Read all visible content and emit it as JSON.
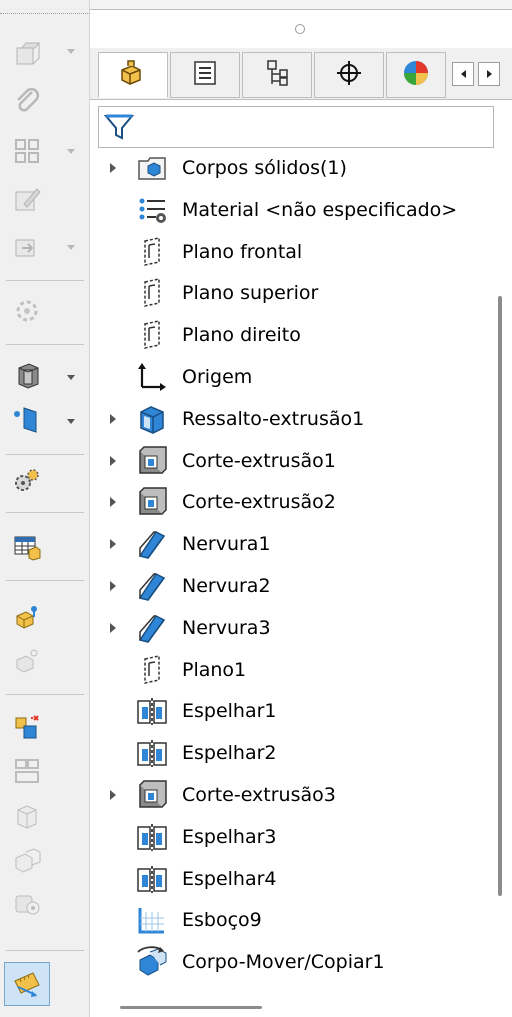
{
  "left_toolbar": {
    "buttons": [
      {
        "icon": "new-part-icon",
        "enabled": false,
        "has_menu": true
      },
      {
        "icon": "paperclip-icon",
        "enabled": false,
        "has_menu": false
      },
      {
        "icon": "pattern-icon",
        "enabled": false,
        "has_menu": true
      },
      {
        "icon": "edit-sketch-icon",
        "enabled": false,
        "has_menu": false
      },
      {
        "icon": "insert-part-icon",
        "enabled": false,
        "has_menu": true
      },
      {
        "icon": "rebuild-icon",
        "enabled": false,
        "has_menu": false
      },
      {
        "icon": "extrude-icon",
        "enabled": true,
        "has_menu": true
      },
      {
        "icon": "reference-plane-icon",
        "enabled": true,
        "has_menu": true
      },
      {
        "icon": "gears-icon",
        "enabled": true,
        "has_menu": false
      },
      {
        "icon": "table-icon",
        "enabled": true,
        "has_menu": false
      },
      {
        "icon": "configuration-icon",
        "enabled": true,
        "has_menu": false
      },
      {
        "icon": "configuration-disabled-icon",
        "enabled": false,
        "has_menu": false
      },
      {
        "icon": "split-part-icon",
        "enabled": true,
        "has_menu": false
      },
      {
        "icon": "weldment-icon",
        "enabled": false,
        "has_menu": false
      },
      {
        "icon": "cube-icon",
        "enabled": false,
        "has_menu": false
      },
      {
        "icon": "assembly-icon",
        "enabled": false,
        "has_menu": false
      },
      {
        "icon": "camera-icon",
        "enabled": false,
        "has_menu": false
      },
      {
        "icon": "measure-icon",
        "enabled": true,
        "has_menu": false
      }
    ]
  },
  "tabs": [
    {
      "icon": "feature-manager-icon",
      "active": true
    },
    {
      "icon": "property-manager-icon",
      "active": false
    },
    {
      "icon": "configuration-manager-icon",
      "active": false
    },
    {
      "icon": "dimxpert-icon",
      "active": false
    },
    {
      "icon": "display-manager-icon",
      "active": false
    }
  ],
  "filter": {
    "icon": "filter-icon"
  },
  "tree": [
    {
      "label": "Corpos sólidos(1)",
      "icon": "solid-bodies-folder-icon",
      "expandable": true
    },
    {
      "label": "Material <não especificado>",
      "icon": "material-icon",
      "expandable": false
    },
    {
      "label": "Plano frontal",
      "icon": "plane-icon",
      "expandable": false
    },
    {
      "label": "Plano superior",
      "icon": "plane-icon",
      "expandable": false
    },
    {
      "label": "Plano direito",
      "icon": "plane-icon",
      "expandable": false
    },
    {
      "label": "Origem",
      "icon": "origin-icon",
      "expandable": false
    },
    {
      "label": "Ressalto-extrusão1",
      "icon": "boss-extrude-icon",
      "expandable": true
    },
    {
      "label": "Corte-extrusão1",
      "icon": "cut-extrude-icon",
      "expandable": true
    },
    {
      "label": "Corte-extrusão2",
      "icon": "cut-extrude-icon",
      "expandable": true
    },
    {
      "label": "Nervura1",
      "icon": "rib-icon",
      "expandable": true
    },
    {
      "label": "Nervura2",
      "icon": "rib-icon",
      "expandable": true
    },
    {
      "label": "Nervura3",
      "icon": "rib-icon",
      "expandable": true
    },
    {
      "label": "Plano1",
      "icon": "plane-icon",
      "expandable": false
    },
    {
      "label": "Espelhar1",
      "icon": "mirror-icon",
      "expandable": false
    },
    {
      "label": "Espelhar2",
      "icon": "mirror-icon",
      "expandable": false
    },
    {
      "label": "Corte-extrusão3",
      "icon": "cut-extrude-icon",
      "expandable": true
    },
    {
      "label": "Espelhar3",
      "icon": "mirror-icon",
      "expandable": false
    },
    {
      "label": "Espelhar4",
      "icon": "mirror-icon",
      "expandable": false
    },
    {
      "label": "Esboço9",
      "icon": "sketch-icon",
      "expandable": false
    },
    {
      "label": "Corpo-Mover/Copiar1",
      "icon": "move-copy-body-icon",
      "expandable": false
    }
  ]
}
